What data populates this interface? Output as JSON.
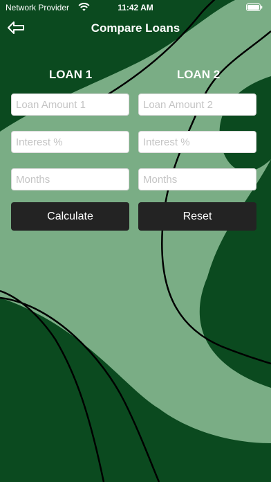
{
  "status_bar": {
    "carrier": "Network Provider",
    "time": "11:42 AM"
  },
  "header": {
    "title": "Compare Loans",
    "back_icon": "back-arrow-icon"
  },
  "loan1": {
    "heading": "LOAN 1",
    "amount_placeholder": "Loan Amount 1",
    "interest_placeholder": "Interest %",
    "months_placeholder": "Months"
  },
  "loan2": {
    "heading": "LOAN 2",
    "amount_placeholder": "Loan Amount 2",
    "interest_placeholder": "Interest %",
    "months_placeholder": "Months"
  },
  "actions": {
    "calculate_label": "Calculate",
    "reset_label": "Reset"
  },
  "colors": {
    "background_dark": "#0b4a1f",
    "background_light": "#7aad85",
    "button": "#232323"
  }
}
